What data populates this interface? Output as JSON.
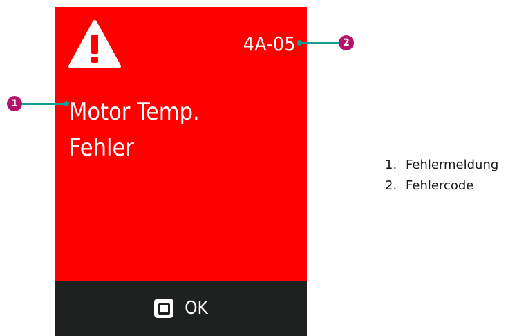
{
  "display": {
    "error_code": "4A-05",
    "message_line1": "Motor Temp.",
    "message_line2": "Fehler",
    "ok_label": "OK",
    "warning_icon": "warning-triangle-icon",
    "ok_icon": "square-button-icon",
    "colors": {
      "background": "#fe0000",
      "bottom_bar": "#1f2120",
      "text": "#ffffff"
    }
  },
  "callouts": [
    {
      "number": "1"
    },
    {
      "number": "2"
    }
  ],
  "legend": {
    "items": [
      {
        "number": "1.",
        "label": "Fehlermeldung"
      },
      {
        "number": "2.",
        "label": "Fehlercode"
      }
    ]
  },
  "annotation_colors": {
    "marker": "#b4136a",
    "line": "#139c8f"
  }
}
